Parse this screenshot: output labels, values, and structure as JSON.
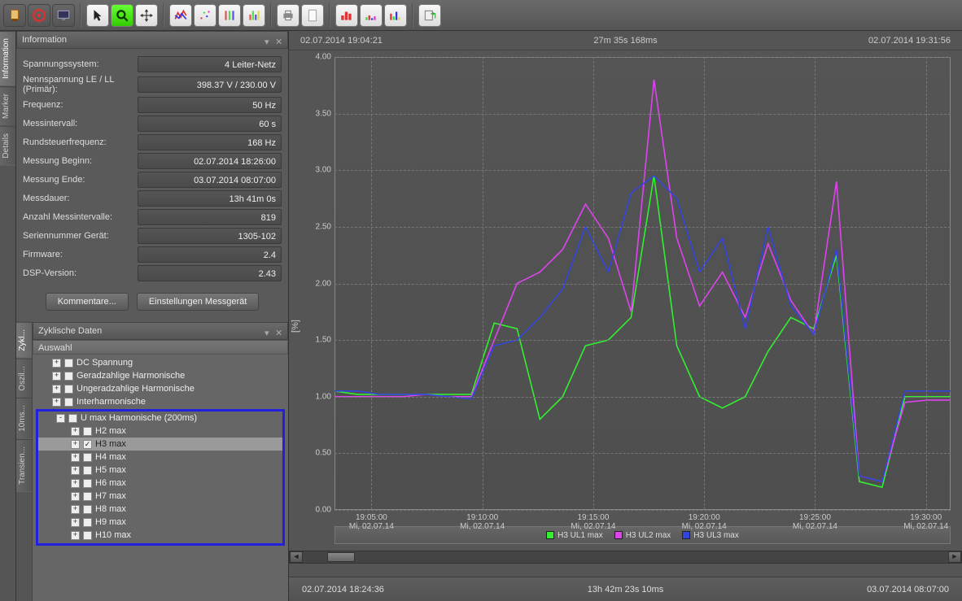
{
  "info_panel": {
    "title": "Information",
    "rows": [
      {
        "label": "Spannungssystem:",
        "value": "4 Leiter-Netz"
      },
      {
        "label": "Nennspannung LE / LL (Primär):",
        "value": "398.37 V / 230.00 V"
      },
      {
        "label": "Frequenz:",
        "value": "50 Hz"
      },
      {
        "label": "Messintervall:",
        "value": "60 s"
      },
      {
        "label": "Rundsteuerfrequenz:",
        "value": "168 Hz"
      },
      {
        "label": "Messung Beginn:",
        "value": "02.07.2014 18:26:00"
      },
      {
        "label": "Messung Ende:",
        "value": "03.07.2014 08:07:00"
      },
      {
        "label": "Messdauer:",
        "value": "13h 41m 0s"
      },
      {
        "label": "Anzahl Messintervalle:",
        "value": "819"
      },
      {
        "label": "Seriennummer Gerät:",
        "value": "1305-102"
      },
      {
        "label": "Firmware:",
        "value": "2.4"
      },
      {
        "label": "DSP-Version:",
        "value": "2.43"
      }
    ],
    "btn_comments": "Kommentare...",
    "btn_settings": "Einstellungen Messgerät"
  },
  "tree_panel": {
    "title": "Zyklische Daten",
    "subheader": "Auswahl",
    "top_nodes": [
      "DC Spannung",
      "Geradzahlige Harmonische",
      "Ungeradzahlige Harmonische",
      "Interharmonische"
    ],
    "hl_parent": "U max Harmonische  (200ms)",
    "hl_children": [
      "H2 max",
      "H3 max",
      "H4 max",
      "H5 max",
      "H6 max",
      "H7 max",
      "H8 max",
      "H9 max",
      "H10 max"
    ],
    "checked_child": "H3 max"
  },
  "side_tabs_left": [
    "Information",
    "Marker",
    "Details"
  ],
  "side_tabs_left2": [
    "Zykl...",
    "Oszil...",
    "10ms...",
    "Transien..."
  ],
  "chart_header": {
    "left": "02.07.2014 19:04:21",
    "center": "27m 35s 168ms",
    "right": "02.07.2014 19:31:56"
  },
  "chart_footer": {
    "left": "02.07.2014 18:24:36",
    "center": "13h 42m 23s 10ms",
    "right": "03.07.2014 08:07:00"
  },
  "legend": [
    {
      "label": "H3 UL1 max",
      "color": "#33ee33"
    },
    {
      "label": "H3 UL2 max",
      "color": "#dd44ee"
    },
    {
      "label": "H3 UL3 max",
      "color": "#3344dd"
    }
  ],
  "ylabel": "[%]",
  "chart_data": {
    "type": "line",
    "ylabel": "[%]",
    "ylim": [
      0,
      4.0
    ],
    "yticks": [
      0.0,
      0.5,
      1.0,
      1.5,
      2.0,
      2.5,
      3.0,
      3.5,
      4.0
    ],
    "x_labels": [
      {
        "t": "19:05:00",
        "d": "Mi, 02.07.14",
        "pos": 0.06
      },
      {
        "t": "19:10:00",
        "d": "Mi, 02.07.14",
        "pos": 0.24
      },
      {
        "t": "19:15:00",
        "d": "Mi, 02.07.14",
        "pos": 0.42
      },
      {
        "t": "19:20:00",
        "d": "Mi, 02.07.14",
        "pos": 0.6
      },
      {
        "t": "19:25:00",
        "d": "Mi, 02.07.14",
        "pos": 0.78
      },
      {
        "t": "19:30:00",
        "d": "Mi, 02.07.14",
        "pos": 0.96
      }
    ],
    "x": [
      0,
      1,
      2,
      3,
      4,
      5,
      6,
      7,
      8,
      9,
      10,
      11,
      12,
      13,
      14,
      15,
      16,
      17,
      18,
      19,
      20,
      21,
      22,
      23,
      24,
      25,
      26,
      27
    ],
    "series": [
      {
        "name": "H3 UL1 max",
        "color": "#33ee33",
        "values": [
          1.05,
          1.02,
          1.02,
          1.02,
          1.02,
          1.02,
          1.02,
          1.65,
          1.6,
          0.8,
          1.0,
          1.45,
          1.5,
          1.7,
          2.95,
          1.45,
          1.0,
          0.9,
          1.0,
          1.4,
          1.7,
          1.6,
          2.25,
          0.25,
          0.2,
          1.0,
          1.0,
          1.0
        ]
      },
      {
        "name": "H3 UL2 max",
        "color": "#dd44ee",
        "values": [
          1.0,
          1.0,
          1.0,
          1.0,
          1.02,
          1.0,
          1.0,
          1.5,
          2.0,
          2.1,
          2.3,
          2.7,
          2.4,
          1.75,
          3.8,
          2.4,
          1.8,
          2.1,
          1.7,
          2.35,
          1.85,
          1.55,
          2.9,
          0.3,
          0.25,
          0.95,
          0.97,
          0.97
        ]
      },
      {
        "name": "H3 UL3 max",
        "color": "#3344dd",
        "values": [
          1.05,
          1.05,
          1.02,
          1.02,
          1.02,
          1.0,
          0.98,
          1.45,
          1.5,
          1.7,
          1.95,
          2.5,
          2.1,
          2.8,
          2.95,
          2.75,
          2.1,
          2.4,
          1.6,
          2.5,
          1.8,
          1.55,
          2.3,
          0.3,
          0.25,
          1.05,
          1.05,
          1.05
        ]
      }
    ]
  }
}
